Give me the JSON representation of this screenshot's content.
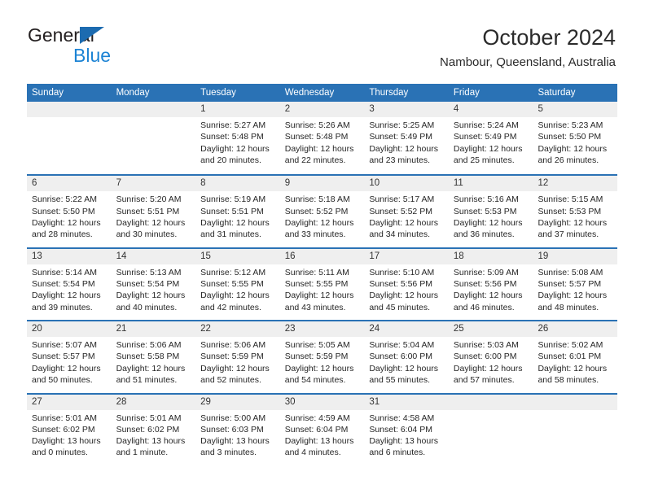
{
  "brand": {
    "word1": "General",
    "word2": "Blue",
    "triangle_color": "#1c6bb0",
    "word2_color": "#1c83d4"
  },
  "header": {
    "title": "October 2024",
    "subtitle": "Nambour, Queensland, Australia"
  },
  "calendar": {
    "header_color": "#2a72b5",
    "daynumber_band_color": "#efefef",
    "weekdays": [
      "Sunday",
      "Monday",
      "Tuesday",
      "Wednesday",
      "Thursday",
      "Friday",
      "Saturday"
    ],
    "weeks": [
      [
        {
          "day": "",
          "sunrise": "",
          "sunset": "",
          "daylight_line1": "",
          "daylight_line2": ""
        },
        {
          "day": "",
          "sunrise": "",
          "sunset": "",
          "daylight_line1": "",
          "daylight_line2": ""
        },
        {
          "day": "1",
          "sunrise": "Sunrise: 5:27 AM",
          "sunset": "Sunset: 5:48 PM",
          "daylight_line1": "Daylight: 12 hours",
          "daylight_line2": "and 20 minutes."
        },
        {
          "day": "2",
          "sunrise": "Sunrise: 5:26 AM",
          "sunset": "Sunset: 5:48 PM",
          "daylight_line1": "Daylight: 12 hours",
          "daylight_line2": "and 22 minutes."
        },
        {
          "day": "3",
          "sunrise": "Sunrise: 5:25 AM",
          "sunset": "Sunset: 5:49 PM",
          "daylight_line1": "Daylight: 12 hours",
          "daylight_line2": "and 23 minutes."
        },
        {
          "day": "4",
          "sunrise": "Sunrise: 5:24 AM",
          "sunset": "Sunset: 5:49 PM",
          "daylight_line1": "Daylight: 12 hours",
          "daylight_line2": "and 25 minutes."
        },
        {
          "day": "5",
          "sunrise": "Sunrise: 5:23 AM",
          "sunset": "Sunset: 5:50 PM",
          "daylight_line1": "Daylight: 12 hours",
          "daylight_line2": "and 26 minutes."
        }
      ],
      [
        {
          "day": "6",
          "sunrise": "Sunrise: 5:22 AM",
          "sunset": "Sunset: 5:50 PM",
          "daylight_line1": "Daylight: 12 hours",
          "daylight_line2": "and 28 minutes."
        },
        {
          "day": "7",
          "sunrise": "Sunrise: 5:20 AM",
          "sunset": "Sunset: 5:51 PM",
          "daylight_line1": "Daylight: 12 hours",
          "daylight_line2": "and 30 minutes."
        },
        {
          "day": "8",
          "sunrise": "Sunrise: 5:19 AM",
          "sunset": "Sunset: 5:51 PM",
          "daylight_line1": "Daylight: 12 hours",
          "daylight_line2": "and 31 minutes."
        },
        {
          "day": "9",
          "sunrise": "Sunrise: 5:18 AM",
          "sunset": "Sunset: 5:52 PM",
          "daylight_line1": "Daylight: 12 hours",
          "daylight_line2": "and 33 minutes."
        },
        {
          "day": "10",
          "sunrise": "Sunrise: 5:17 AM",
          "sunset": "Sunset: 5:52 PM",
          "daylight_line1": "Daylight: 12 hours",
          "daylight_line2": "and 34 minutes."
        },
        {
          "day": "11",
          "sunrise": "Sunrise: 5:16 AM",
          "sunset": "Sunset: 5:53 PM",
          "daylight_line1": "Daylight: 12 hours",
          "daylight_line2": "and 36 minutes."
        },
        {
          "day": "12",
          "sunrise": "Sunrise: 5:15 AM",
          "sunset": "Sunset: 5:53 PM",
          "daylight_line1": "Daylight: 12 hours",
          "daylight_line2": "and 37 minutes."
        }
      ],
      [
        {
          "day": "13",
          "sunrise": "Sunrise: 5:14 AM",
          "sunset": "Sunset: 5:54 PM",
          "daylight_line1": "Daylight: 12 hours",
          "daylight_line2": "and 39 minutes."
        },
        {
          "day": "14",
          "sunrise": "Sunrise: 5:13 AM",
          "sunset": "Sunset: 5:54 PM",
          "daylight_line1": "Daylight: 12 hours",
          "daylight_line2": "and 40 minutes."
        },
        {
          "day": "15",
          "sunrise": "Sunrise: 5:12 AM",
          "sunset": "Sunset: 5:55 PM",
          "daylight_line1": "Daylight: 12 hours",
          "daylight_line2": "and 42 minutes."
        },
        {
          "day": "16",
          "sunrise": "Sunrise: 5:11 AM",
          "sunset": "Sunset: 5:55 PM",
          "daylight_line1": "Daylight: 12 hours",
          "daylight_line2": "and 43 minutes."
        },
        {
          "day": "17",
          "sunrise": "Sunrise: 5:10 AM",
          "sunset": "Sunset: 5:56 PM",
          "daylight_line1": "Daylight: 12 hours",
          "daylight_line2": "and 45 minutes."
        },
        {
          "day": "18",
          "sunrise": "Sunrise: 5:09 AM",
          "sunset": "Sunset: 5:56 PM",
          "daylight_line1": "Daylight: 12 hours",
          "daylight_line2": "and 46 minutes."
        },
        {
          "day": "19",
          "sunrise": "Sunrise: 5:08 AM",
          "sunset": "Sunset: 5:57 PM",
          "daylight_line1": "Daylight: 12 hours",
          "daylight_line2": "and 48 minutes."
        }
      ],
      [
        {
          "day": "20",
          "sunrise": "Sunrise: 5:07 AM",
          "sunset": "Sunset: 5:57 PM",
          "daylight_line1": "Daylight: 12 hours",
          "daylight_line2": "and 50 minutes."
        },
        {
          "day": "21",
          "sunrise": "Sunrise: 5:06 AM",
          "sunset": "Sunset: 5:58 PM",
          "daylight_line1": "Daylight: 12 hours",
          "daylight_line2": "and 51 minutes."
        },
        {
          "day": "22",
          "sunrise": "Sunrise: 5:06 AM",
          "sunset": "Sunset: 5:59 PM",
          "daylight_line1": "Daylight: 12 hours",
          "daylight_line2": "and 52 minutes."
        },
        {
          "day": "23",
          "sunrise": "Sunrise: 5:05 AM",
          "sunset": "Sunset: 5:59 PM",
          "daylight_line1": "Daylight: 12 hours",
          "daylight_line2": "and 54 minutes."
        },
        {
          "day": "24",
          "sunrise": "Sunrise: 5:04 AM",
          "sunset": "Sunset: 6:00 PM",
          "daylight_line1": "Daylight: 12 hours",
          "daylight_line2": "and 55 minutes."
        },
        {
          "day": "25",
          "sunrise": "Sunrise: 5:03 AM",
          "sunset": "Sunset: 6:00 PM",
          "daylight_line1": "Daylight: 12 hours",
          "daylight_line2": "and 57 minutes."
        },
        {
          "day": "26",
          "sunrise": "Sunrise: 5:02 AM",
          "sunset": "Sunset: 6:01 PM",
          "daylight_line1": "Daylight: 12 hours",
          "daylight_line2": "and 58 minutes."
        }
      ],
      [
        {
          "day": "27",
          "sunrise": "Sunrise: 5:01 AM",
          "sunset": "Sunset: 6:02 PM",
          "daylight_line1": "Daylight: 13 hours",
          "daylight_line2": "and 0 minutes."
        },
        {
          "day": "28",
          "sunrise": "Sunrise: 5:01 AM",
          "sunset": "Sunset: 6:02 PM",
          "daylight_line1": "Daylight: 13 hours",
          "daylight_line2": "and 1 minute."
        },
        {
          "day": "29",
          "sunrise": "Sunrise: 5:00 AM",
          "sunset": "Sunset: 6:03 PM",
          "daylight_line1": "Daylight: 13 hours",
          "daylight_line2": "and 3 minutes."
        },
        {
          "day": "30",
          "sunrise": "Sunrise: 4:59 AM",
          "sunset": "Sunset: 6:04 PM",
          "daylight_line1": "Daylight: 13 hours",
          "daylight_line2": "and 4 minutes."
        },
        {
          "day": "31",
          "sunrise": "Sunrise: 4:58 AM",
          "sunset": "Sunset: 6:04 PM",
          "daylight_line1": "Daylight: 13 hours",
          "daylight_line2": "and 6 minutes."
        },
        {
          "day": "",
          "sunrise": "",
          "sunset": "",
          "daylight_line1": "",
          "daylight_line2": ""
        },
        {
          "day": "",
          "sunrise": "",
          "sunset": "",
          "daylight_line1": "",
          "daylight_line2": ""
        }
      ]
    ]
  }
}
